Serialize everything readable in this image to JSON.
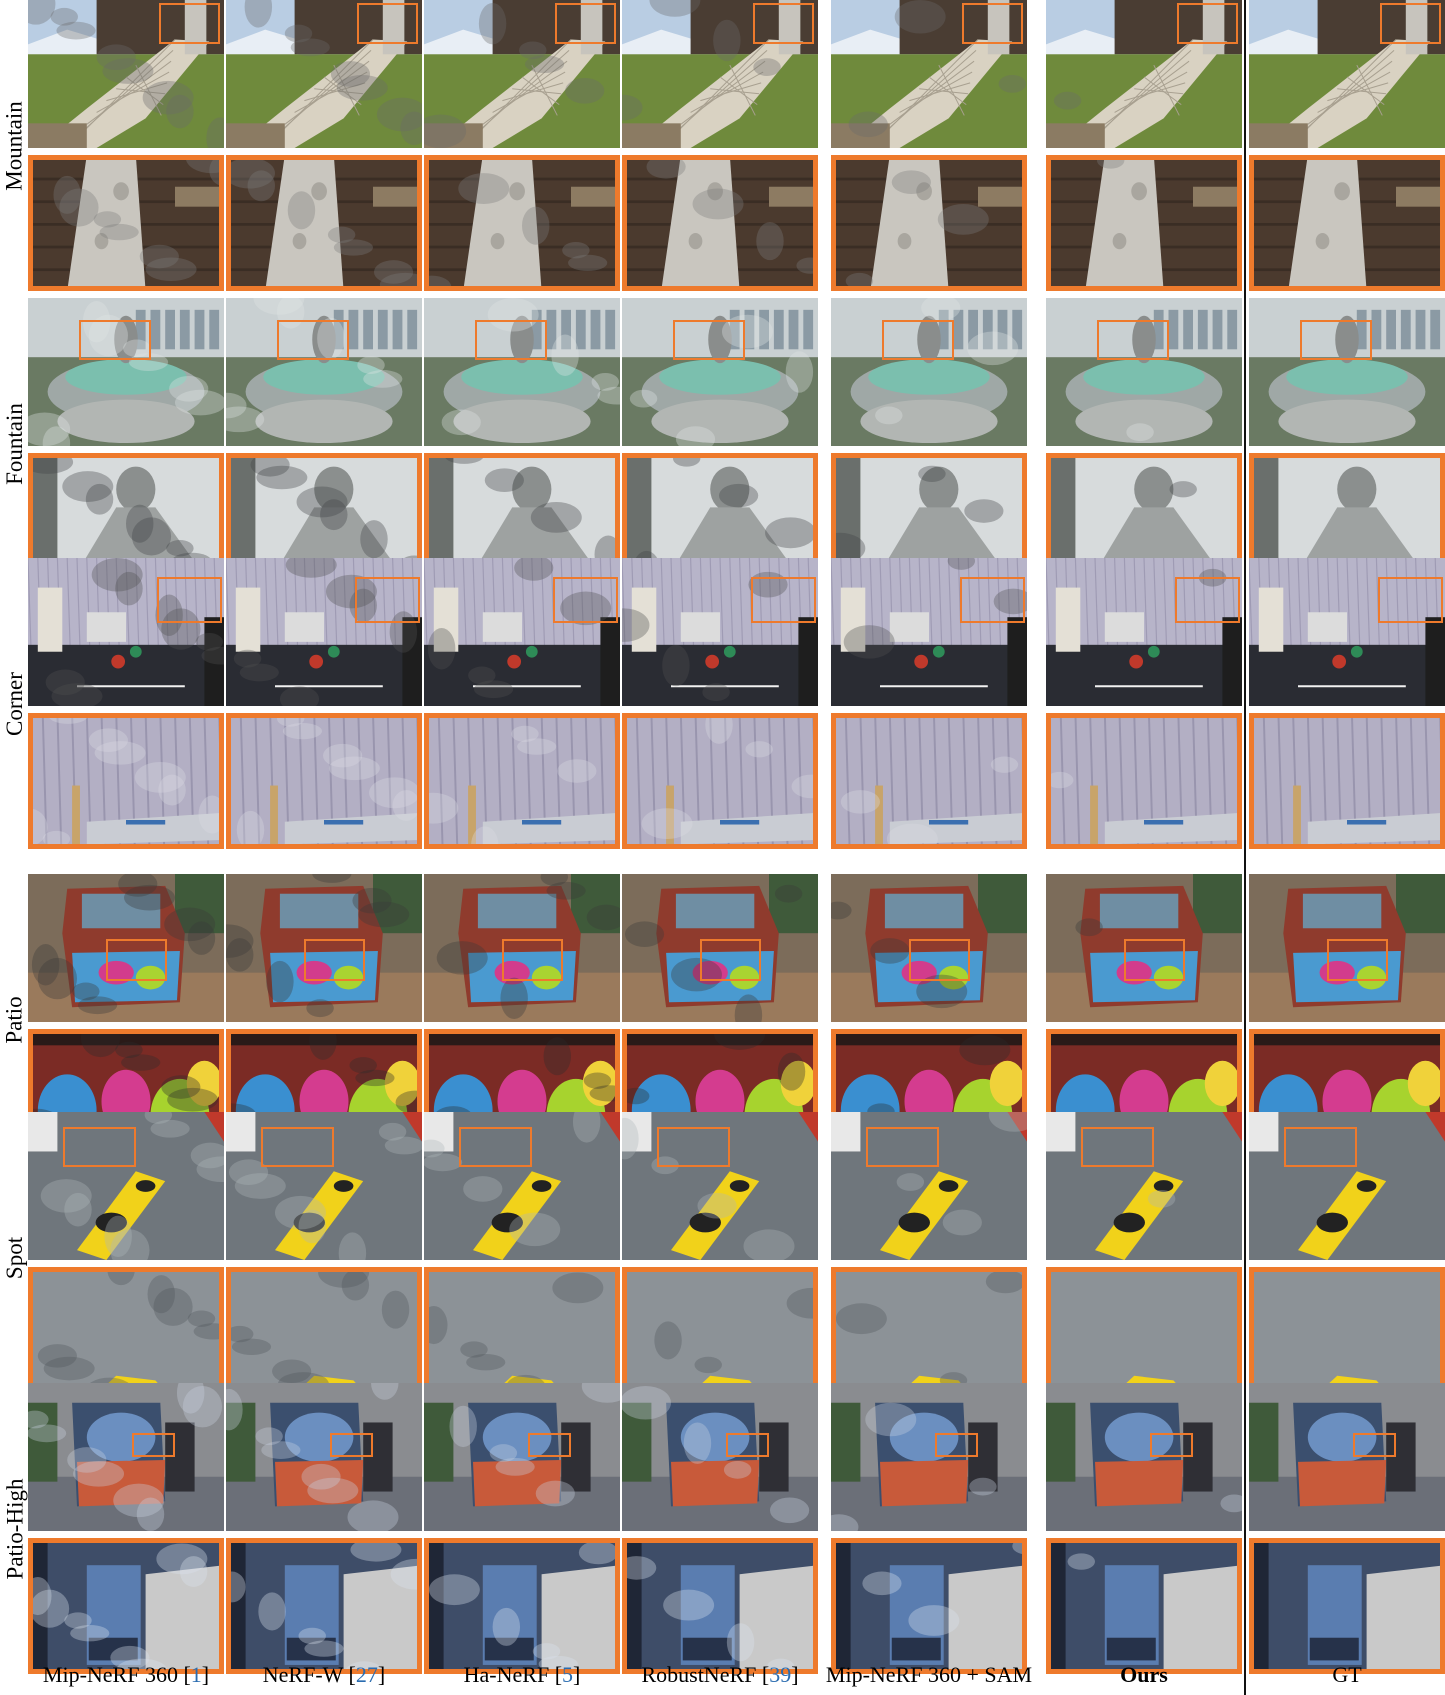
{
  "figure": {
    "rows": [
      {
        "label": "Mountain",
        "scene": "mountain"
      },
      {
        "label": "Fountain",
        "scene": "fountain"
      },
      {
        "label": "Corner",
        "scene": "corner"
      },
      {
        "label": "Patio",
        "scene": "patio"
      },
      {
        "label": "Spot",
        "scene": "spot"
      },
      {
        "label": "Patio-High",
        "scene": "patiohigh"
      }
    ],
    "columns": [
      {
        "name": "Mip-NeRF 360",
        "ref": "1",
        "bold": false
      },
      {
        "name": "NeRF-W",
        "ref": "27",
        "bold": false
      },
      {
        "name": "Ha-NeRF",
        "ref": "5",
        "bold": false
      },
      {
        "name": "RobustNeRF",
        "ref": "39",
        "bold": false
      },
      {
        "name": "Mip-NeRF 360 + SAM",
        "ref": "",
        "bold": false
      },
      {
        "name": "Ours",
        "ref": "",
        "bold": true
      },
      {
        "name": "GT",
        "ref": "",
        "bold": false
      }
    ],
    "colors": {
      "highlight": "#ee7a2c",
      "reference_link": "#2a6cb0",
      "divider": "#111111"
    }
  }
}
